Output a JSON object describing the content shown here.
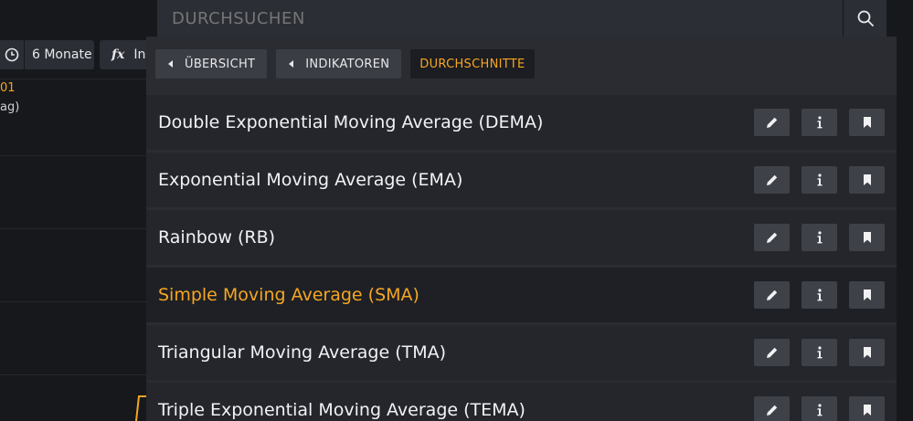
{
  "background": {
    "period_label": "6 Monate",
    "fx_glyph": "fx",
    "fx_label": "In",
    "value_text": "01",
    "sub_text": "ag)"
  },
  "search": {
    "placeholder": "DURCHSUCHEN"
  },
  "breadcrumbs": [
    {
      "label": "ÜBERSICHT"
    },
    {
      "label": "INDIKATOREN"
    },
    {
      "label": "DURCHSCHNITTE"
    }
  ],
  "indicators": [
    {
      "label": "Double Exponential Moving Average (DEMA)"
    },
    {
      "label": "Exponential Moving Average (EMA)"
    },
    {
      "label": "Rainbow (RB)"
    },
    {
      "label": "Simple Moving Average (SMA)"
    },
    {
      "label": "Triangular Moving Average (TMA)"
    },
    {
      "label": "Triple Exponential Moving Average (TEMA)"
    }
  ],
  "colors": {
    "accent": "#f5a623",
    "panel": "#2a2c32",
    "row": "#24262c",
    "button": "#3e4148"
  },
  "icons": {
    "edit": "pencil-icon",
    "info": "info-icon",
    "bookmark": "bookmark-icon",
    "search": "search-icon"
  }
}
